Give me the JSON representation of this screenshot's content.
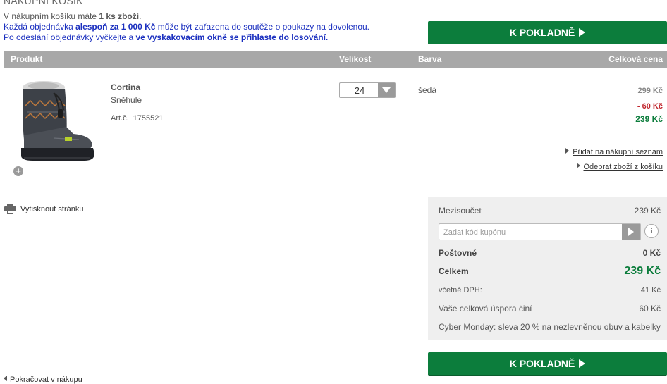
{
  "header": {
    "title": "NÁKUPNÍ KOŠÍK",
    "line1": {
      "pre": "V nákupním košíku máte ",
      "count": "1 ks zboží",
      "post": "."
    },
    "line2": {
      "pre": "Každá objednávka ",
      "bold": "alespoň za 1 000 Kč",
      "post": " může být zařazena do soutěže o poukazy na dovolenou."
    },
    "line3": {
      "pre": "Po odeslání objednávky vyčkejte a ",
      "bold": "ve vyskakovacím okně se přihlaste do losování."
    }
  },
  "checkout_label": "K POKLADNĚ",
  "table": {
    "headers": {
      "product": "Produkt",
      "size": "Velikost",
      "color": "Barva",
      "total": "Celková cena"
    }
  },
  "item": {
    "name": "Cortina",
    "subtitle": "Sněhule",
    "art_label": "Art.č.",
    "art_number": "1755521",
    "size": "24",
    "color": "šedá",
    "price_original": "299 Kč",
    "discount": "- 60 Kč",
    "price_final": "239 Kč",
    "add_to_list": "Přidat na nákupní seznam",
    "remove": "Odebrat zboží z košíku"
  },
  "print_label": "Vytisknout stránku",
  "summary": {
    "subtotal_label": "Mezisoučet",
    "subtotal_value": "239 Kč",
    "coupon_placeholder": "Zadat kód kupónu",
    "shipping_label": "Poštovné",
    "shipping_value": "0 Kč",
    "total_label": "Celkem",
    "total_value": "239 Kč",
    "vat_label": "včetně DPH:",
    "vat_value": "41 Kč",
    "savings_label": "Vaše celková úspora činí",
    "savings_value": "60 Kč",
    "promo": "Cyber Monday: sleva 20 % na nezlevněnou obuv a kabelky"
  },
  "continue_label": "Pokračovat v nákupu",
  "colors": {
    "accent_green": "#0c7d3c",
    "discount_red": "#c0262d",
    "header_grey": "#a8a8a8"
  }
}
